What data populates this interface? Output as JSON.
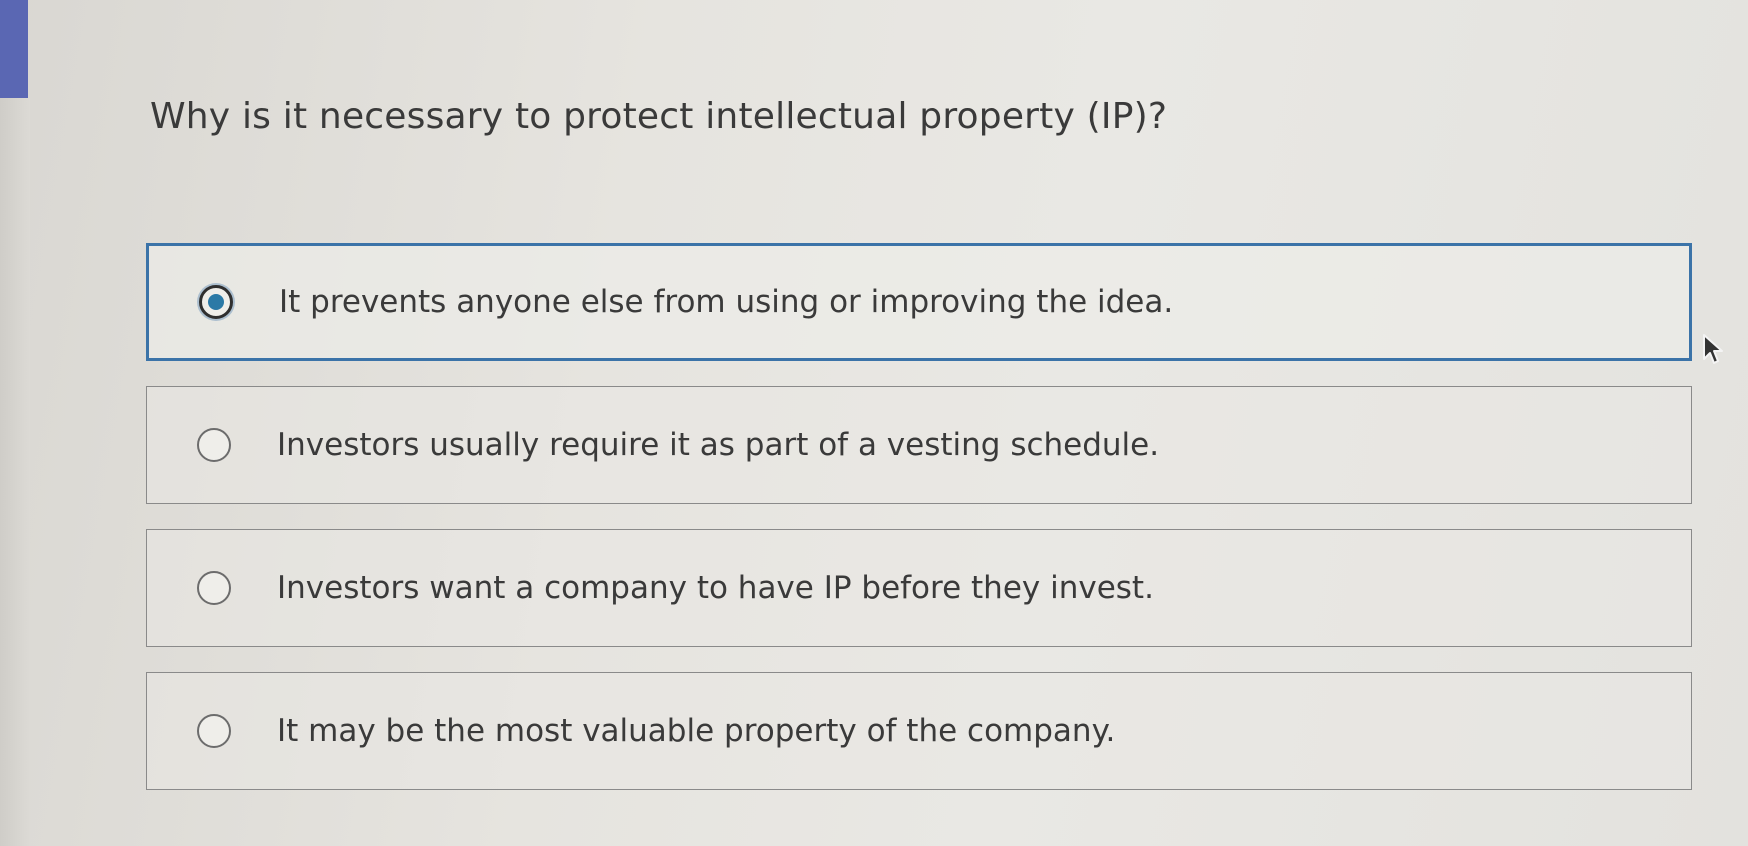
{
  "question": {
    "text": "Why is it necessary to protect intellectual property (IP)?"
  },
  "options": [
    {
      "label": "It prevents anyone else from using or improving the idea.",
      "selected": true
    },
    {
      "label": "Investors usually require it as part of a vesting schedule.",
      "selected": false
    },
    {
      "label": "Investors want a company to have IP before they invest.",
      "selected": false
    },
    {
      "label": "It may be the most valuable property of the company.",
      "selected": false
    }
  ],
  "colors": {
    "accent_bar": "#5a67b3",
    "selected_border": "#3b73a8",
    "radio_fill": "#2b79a6"
  },
  "icons": {
    "cursor": "mouse-pointer-icon"
  }
}
